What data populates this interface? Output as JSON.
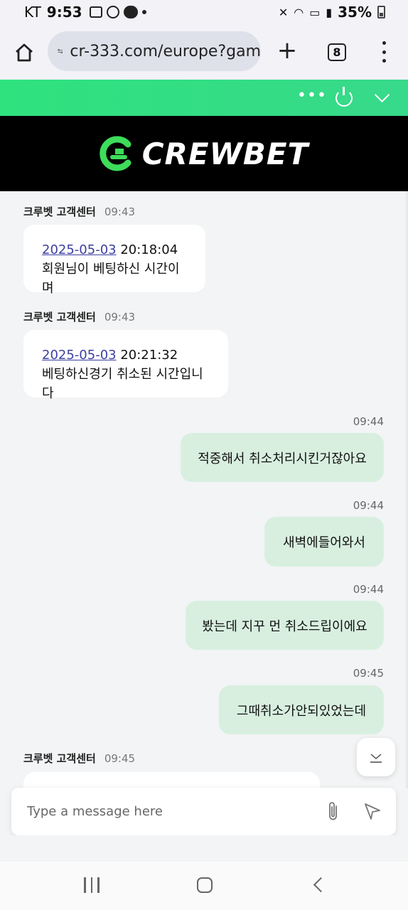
{
  "status_bar": {
    "carrier": "KT",
    "time": "9:53",
    "battery": "35%"
  },
  "browser": {
    "url": "cr-333.com/europe?gam",
    "tab_count": "8"
  },
  "brand": {
    "name": "CREWBET",
    "colors": {
      "header_green": "#2fe27e",
      "logo_green": "#3ddc5a",
      "bubble_out": "#d8efe0"
    }
  },
  "chat": {
    "messages_in": [
      {
        "sender": "크루벳 고객센터",
        "time": "09:43",
        "date": "2025-05-03",
        "clock": " 20:18:04",
        "line2": "회원님이 베팅하신 시간이며"
      },
      {
        "sender": "크루벳 고객센터",
        "time": "09:43",
        "date": "2025-05-03",
        "clock": " 20:21:32",
        "line2": "베팅하신경기 취소된 시간입니다"
      },
      {
        "sender": "크루벳 고객센터",
        "time": "09:45"
      }
    ],
    "messages_out": [
      {
        "time": "09:44",
        "text": "적중해서 취소처리시킨거잖아요"
      },
      {
        "time": "09:44",
        "text": "새벽에들어와서"
      },
      {
        "time": "09:44",
        "text": "봤는데 지꾸 먼 취소드립이에요"
      },
      {
        "time": "09:45",
        "text": "그때취소가안되있었는데"
      }
    ]
  },
  "composer": {
    "placeholder": "Type a message here"
  }
}
